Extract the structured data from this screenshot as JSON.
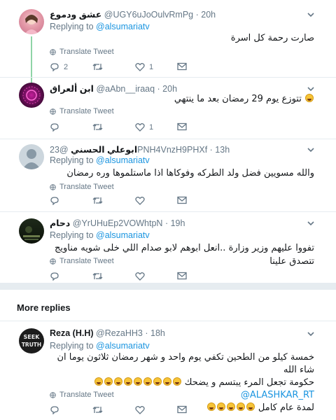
{
  "tweets": [
    {
      "name": "عشق ودموع",
      "handle": "@UGY6uJoOulvRmPg",
      "time": "· 20h",
      "replying_prefix": "Replying to ",
      "replying_handle": "@alsumariatv",
      "text": "صارت رحمة كل اسرة",
      "translate": "Translate Tweet",
      "replies": "2",
      "retweets": "",
      "likes": "1"
    },
    {
      "name": "ابن ألعراق",
      "handle": "@aAbn__iraaq",
      "time": "· 20h",
      "text": "تتوزع يوم 29 رمضان بعد ما ينتهي",
      "translate": "Translate Tweet",
      "replies": "",
      "retweets": "",
      "likes": "1"
    },
    {
      "name": "ابوعلي الحسني",
      "handle": "@23PNH4VnzH9PHXf",
      "time": "· 13h",
      "replying_prefix": "Replying to ",
      "replying_handle": "@alsumariatv",
      "text": "والله مسويين فضل ولد الطركه وفوكاها اذا ماستلموها وره رمضان",
      "translate": "Translate Tweet"
    },
    {
      "name": "دحام",
      "handle": "@YrUHuEp2VOWhtpN",
      "time": "· 19h",
      "replying_prefix": "Replying to ",
      "replying_handle": "@alsumariatv",
      "text": "تفووا عليهم وزير وزارة ..انعل ابوهم لابو صدام اللي خلى شويه مناويج تتصدق علينا",
      "translate": "Translate Tweet"
    },
    {
      "name": "Reza (H.H)",
      "handle": "@RezaHH3",
      "time": "· 18h",
      "replying_prefix": "Replying to ",
      "replying_handle": "@alsumariatv",
      "text_line1": "خمسة كيلو من الطحين تكفي يوم واحد و شهر رمضان ثلاثون يوما ان شاء الله",
      "mention": "@ALASHKAR_RT",
      "text_line2": "حكومة تجعل المرء يبتسم و يضحك",
      "text_line3": "لمدة عام كامل",
      "translate": "Translate Tweet"
    }
  ],
  "more_replies_label": "More replies",
  "colors": {
    "link": "#1b95e0",
    "meta": "#657786",
    "thread": "#8fd4a7",
    "divider": "#e6ecf0"
  }
}
